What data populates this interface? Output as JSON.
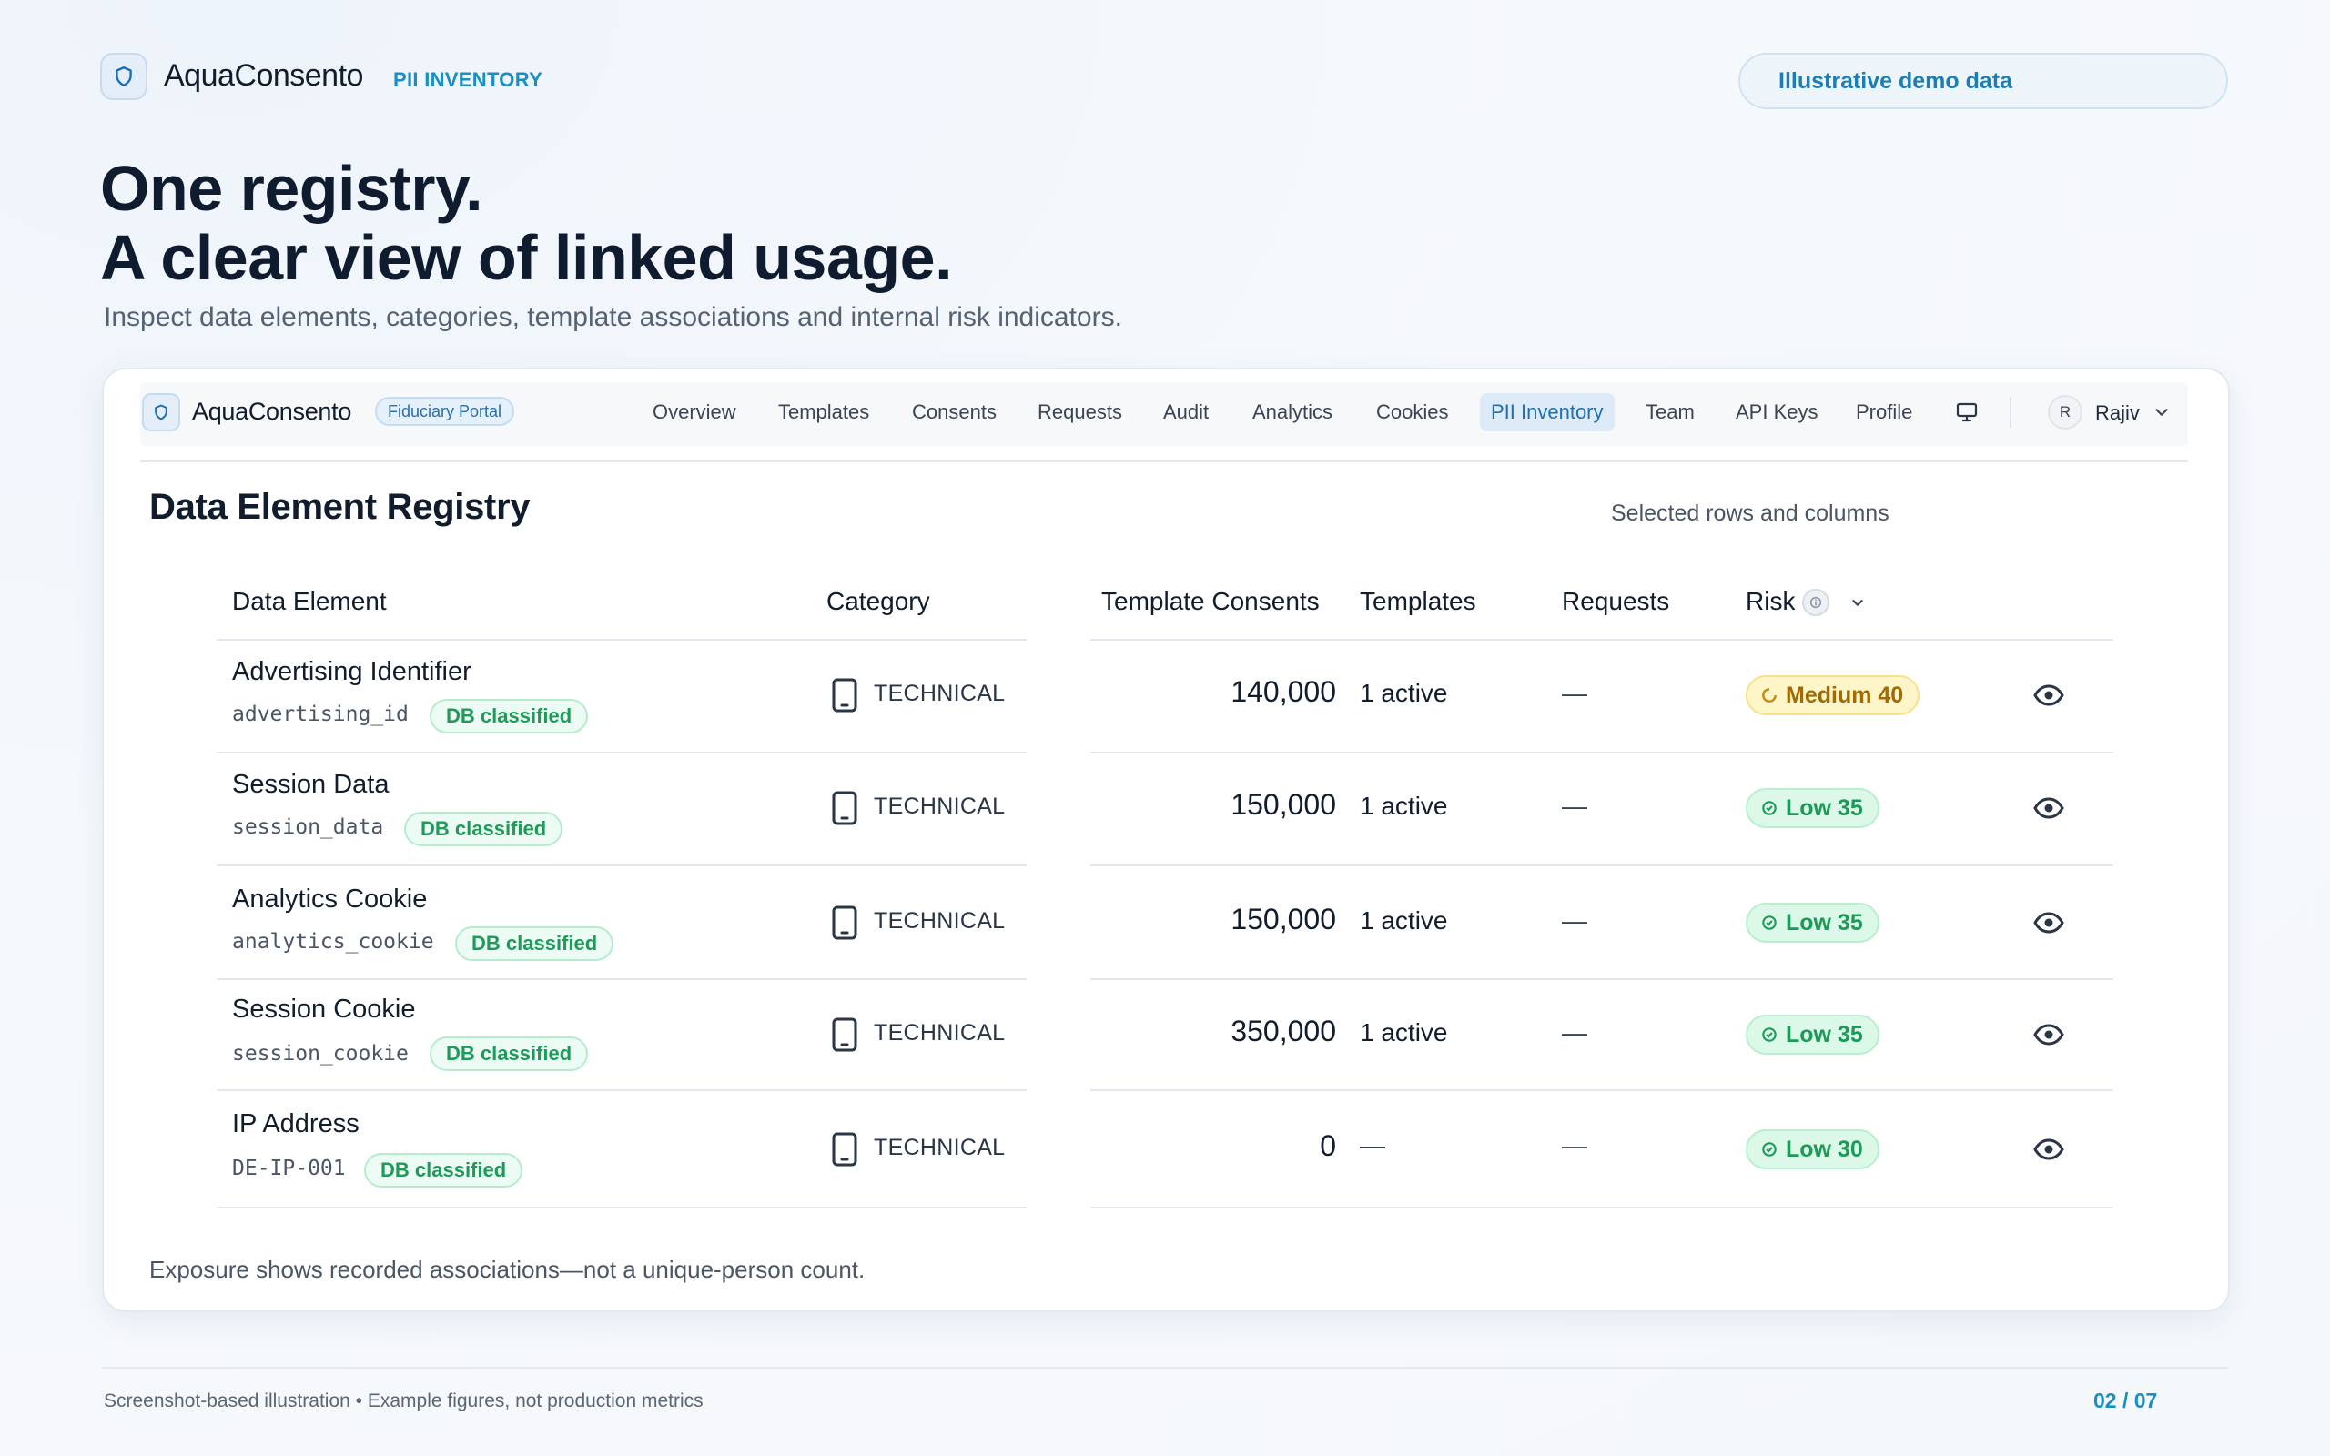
{
  "header": {
    "brand": "AquaConsento",
    "section": "PII INVENTORY",
    "demo_label": "Illustrative demo data"
  },
  "hero": {
    "line1": "One registry.",
    "line2": "A clear view of linked usage.",
    "subtitle": "Inspect data elements, categories, template associations and internal risk indicators."
  },
  "app": {
    "name": "AquaConsento",
    "portal_badge": "Fiduciary Portal",
    "nav": [
      "Overview",
      "Templates",
      "Consents",
      "Requests",
      "Audit",
      "Analytics",
      "Cookies",
      "PII Inventory",
      "Team",
      "API Keys",
      "Profile"
    ],
    "active_nav": "PII Inventory",
    "user": {
      "initial": "R",
      "name": "Rajiv"
    },
    "icons": {
      "brand": "shield-icon",
      "display": "monitor-icon",
      "user_menu": "chevron-down-icon"
    }
  },
  "registry": {
    "title": "Data Element Registry",
    "selection_note": "Selected rows and columns",
    "columns": {
      "element": "Data Element",
      "category": "Category",
      "consents": "Template Consents",
      "templates": "Templates",
      "requests": "Requests",
      "risk": "Risk"
    },
    "rows": [
      {
        "name": "Advertising Identifier",
        "code": "advertising_id",
        "classification": "DB classified",
        "category": "TECHNICAL",
        "consents": "140,000",
        "templates": "1 active",
        "requests": "—",
        "risk": "Medium 40",
        "risk_level": "medium"
      },
      {
        "name": "Session Data",
        "code": "session_data",
        "classification": "DB classified",
        "category": "TECHNICAL",
        "consents": "150,000",
        "templates": "1 active",
        "requests": "—",
        "risk": "Low 35",
        "risk_level": "low"
      },
      {
        "name": "Analytics Cookie",
        "code": "analytics_cookie",
        "classification": "DB classified",
        "category": "TECHNICAL",
        "consents": "150,000",
        "templates": "1 active",
        "requests": "—",
        "risk": "Low 35",
        "risk_level": "low"
      },
      {
        "name": "Session Cookie",
        "code": "session_cookie",
        "classification": "DB classified",
        "category": "TECHNICAL",
        "consents": "350,000",
        "templates": "1 active",
        "requests": "—",
        "risk": "Low 35",
        "risk_level": "low"
      },
      {
        "name": "IP Address",
        "code": "DE-IP-001",
        "classification": "DB classified",
        "category": "TECHNICAL",
        "consents": "0",
        "templates": "—",
        "requests": "—",
        "risk": "Low 30",
        "risk_level": "low"
      }
    ],
    "footnote": "Exposure shows recorded associations—not a unique-person count."
  },
  "footer": {
    "note": "Screenshot-based illustration • Example figures, not production metrics",
    "page": "02 / 07"
  },
  "colors": {
    "accent": "#1a8fc4",
    "heading": "#0f1b2e",
    "badge_green": "#1f9a5b",
    "badge_medium": "#a06a04"
  }
}
